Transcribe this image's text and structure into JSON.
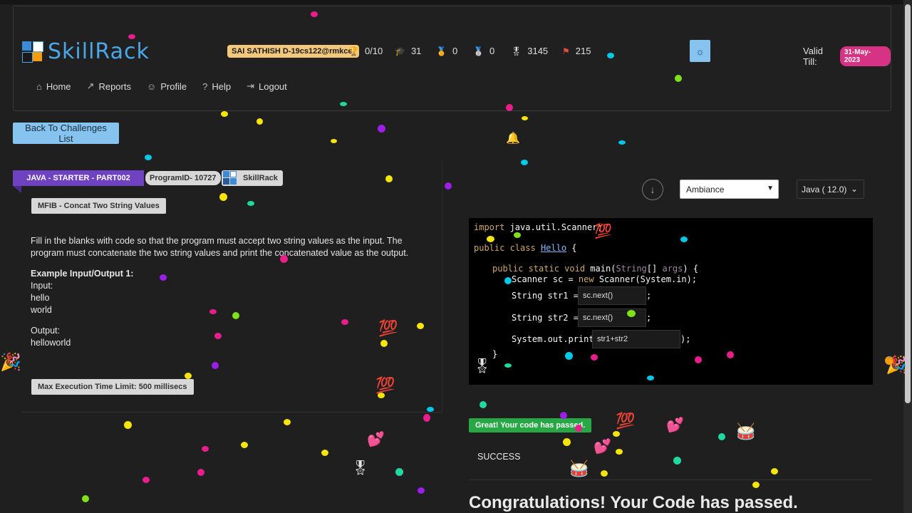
{
  "brand": {
    "name": "SkillRack"
  },
  "header": {
    "user": "SAI SATHISH D-19cs122@rmkcet",
    "stats": [
      {
        "icon": "trophy-icon",
        "value": "0/10"
      },
      {
        "icon": "graduation-cap-icon",
        "value": "31"
      },
      {
        "icon": "gold-medal-icon",
        "value": "0"
      },
      {
        "icon": "silver-medal-icon",
        "value": "0"
      },
      {
        "icon": "bronze-medal-icon",
        "value": "3145"
      },
      {
        "icon": "flag-icon",
        "value": "215"
      }
    ],
    "valid_label": "Valid Till:",
    "valid_date": "31-May-2023",
    "nav": [
      {
        "icon": "home-icon",
        "label": "Home"
      },
      {
        "icon": "chart-icon",
        "label": "Reports"
      },
      {
        "icon": "user-icon",
        "label": "Profile"
      },
      {
        "icon": "question-icon",
        "label": "Help"
      },
      {
        "icon": "logout-icon",
        "label": "Logout"
      }
    ]
  },
  "back_button": "Back To Challenges List",
  "challenge": {
    "track": "JAVA - STARTER - PART002",
    "program_id": "ProgramID- 10727",
    "source": "SkillRack",
    "title": "MFIB - Concat Two String Values",
    "description": "Fill in the blanks with code so that the program must accept two string values as the input. The program must concatenate the two string values and print the concatenated value as the output.",
    "example_heading": "Example Input/Output 1:",
    "input_label": "Input:",
    "input_lines": [
      "hello",
      "world"
    ],
    "output_label": "Output:",
    "output_lines": [
      "helloworld"
    ],
    "max_exec": "Max Execution Time Limit: 500 millisecs"
  },
  "editor": {
    "theme_options_selected": "Ambiance",
    "language_selected": "Java ( 12.0)",
    "blanks": [
      "sc.next()",
      "sc.next()",
      "str1+str2"
    ]
  },
  "result": {
    "badge": "Great! Your code has passed.",
    "status": "SUCCESS",
    "congrats": "Congratulations! Your Code has passed."
  }
}
